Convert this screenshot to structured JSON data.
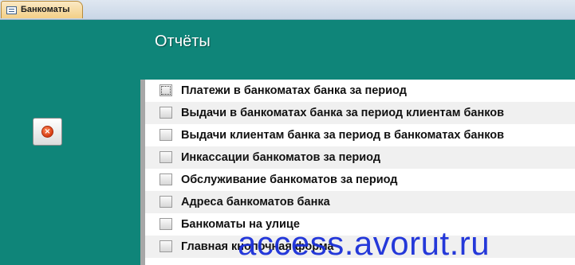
{
  "tab": {
    "label": "Банкоматы",
    "icon": "form-icon"
  },
  "header": {
    "title": "Отчёты"
  },
  "close_button": {
    "icon": "close-icon",
    "glyph": "×"
  },
  "menu": {
    "items": [
      {
        "label": "Платежи в банкоматах банка за период"
      },
      {
        "label": "Выдачи в банкоматах банка за период клиентам банков"
      },
      {
        "label": "Выдачи клиентам банка за период в банкоматах банков"
      },
      {
        "label": "Инкассации банкоматов за период"
      },
      {
        "label": "Обслуживание банкоматов за период"
      },
      {
        "label": "Адреса банкоматов банка"
      },
      {
        "label": "Банкоматы на улице"
      },
      {
        "label": "Главная кнопочная форма"
      }
    ]
  },
  "watermark": {
    "text": "access.avorut.ru"
  },
  "colors": {
    "header": "#0f8579",
    "accent": "#1a2fd8",
    "separator": "#a7a7a7"
  }
}
